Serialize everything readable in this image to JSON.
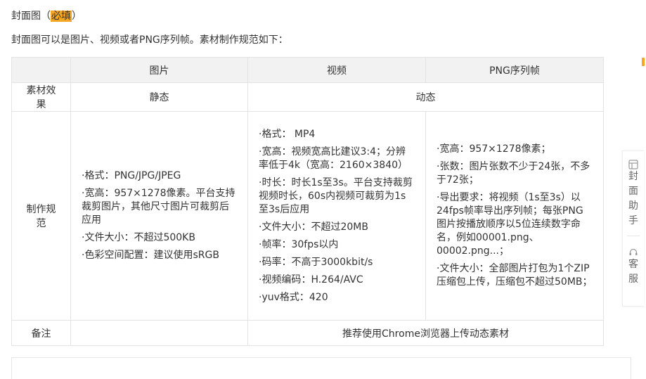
{
  "heading": {
    "text": "封面图（",
    "required": "必填",
    "close": "）"
  },
  "description": "封面图可以是图片、视频或者PNG序列帧。素材制作规范如下：",
  "table": {
    "headers": [
      "",
      "图片",
      "视频",
      "PNG序列帧"
    ],
    "effect": {
      "label": "素材效果",
      "image": "静态",
      "dynamic": "动态"
    },
    "spec_label": "制作规范",
    "image_specs": [
      "·格式：PNG/JPG/JPEG",
      "·宽高：957×1278像素。平台支持裁剪图片，其他尺寸图片可裁剪后应用",
      "·文件大小：不超过500KB",
      "·色彩空间配置：建议使用sRGB"
    ],
    "video_specs": [
      "·格式： MP4",
      "·宽高：视频宽高比建议3:4；分辨率低于4k（宽高：2160×3840）",
      "·时长：时长1s至3s。平台支持裁剪视频时长，60s内视频可裁剪为1s至3s后应用",
      "·文件大小：不超过20MB",
      "·帧率：30fps以内",
      "·码率：不高于3000kbit/s",
      "·视频编码：H.264/AVC",
      "·yuv格式：420"
    ],
    "png_specs": [
      "·宽高：957×1278像素；",
      "·张数：图片张数不少于24张，不多于72张；",
      "·导出要求：将视频（1s至3s）以24fps帧率导出序列帧；每张PNG图片按播放顺序以5位连续数字命名，例如00001.png、00002.png...；",
      "·文件大小：全部图片打包为1个ZIP压缩包上传，压缩包不超过50MB；"
    ],
    "note": {
      "label": "备注",
      "image": "",
      "dynamic": "推荐使用Chrome浏览器上传动态素材"
    }
  },
  "sidebar": {
    "helper": {
      "icon": "cover-helper-icon",
      "label_chars": [
        "封",
        "面",
        "助",
        "手"
      ]
    },
    "service": {
      "icon": "headset-icon",
      "label_chars": [
        "客",
        "服"
      ]
    }
  },
  "colors": {
    "required_highlight": "#f5a623",
    "header_bg": "#f2f2f2",
    "border": "#e3e3e3"
  }
}
